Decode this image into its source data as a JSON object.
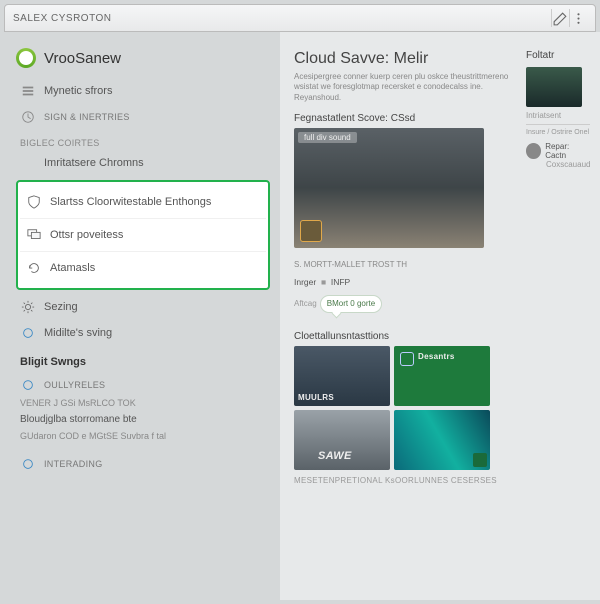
{
  "titlebar": {
    "title": "SALEX CYSROTON"
  },
  "sidebar": {
    "brand": "VrooSanew",
    "items": [
      {
        "icon": "stack",
        "label": "Mynetic sfrors"
      },
      {
        "icon": "clock",
        "label": "SIGN & INERTRIES"
      }
    ],
    "group1_label": "BIGLEC COIRTES",
    "group1": [
      {
        "icon": "",
        "label": "Imritatsere Chromns"
      }
    ],
    "highlighted": [
      {
        "icon": "shield",
        "label": "Slartss Cloorwitestable Enthongs"
      },
      {
        "icon": "monitor",
        "label": "Ottsr poveitess"
      },
      {
        "icon": "refresh",
        "label": "Atamasls"
      }
    ],
    "after": [
      {
        "icon": "gear",
        "label": "Sezing"
      },
      {
        "icon": "circle",
        "label": "Midilte's sving"
      }
    ],
    "section2_header": "Bligit Swngs",
    "section2": [
      {
        "icon": "dot",
        "label": "OULLYRELES"
      }
    ],
    "footer_lines": [
      "VENER J GSi MsRLCO TOK",
      "Bloudjglba storromane bte",
      "GUdaron COD e MGtSE Suvbra f tal"
    ],
    "bottom": {
      "icon": "dot",
      "label": "INTERADING"
    }
  },
  "content": {
    "heading": "Cloud Savve: Melir",
    "description": "Acesipergree conner kuerp ceren plu oskce theustrittmereno wsistat we foresglotmap recersket e conodecalss ine. Reyanshoud.",
    "subhead": "Fegnastatlent Scove: CSsd",
    "hero_tag": "full div sound",
    "caption_line": "S. MORTT-MALLET TROST TH",
    "meta_label": "Inrger",
    "meta_value": "INFP",
    "attach_label": "Aftcag",
    "bubble": "BMort 0 gorte",
    "section2": "Cloettallunsntasttions",
    "thumbs": [
      {
        "cap": "MUULRS"
      },
      {
        "cap": "Desantrs"
      },
      {
        "cap": "SAWE"
      },
      {
        "cap": ""
      }
    ],
    "bottom_line": "MESETENPRETIONAL  KsOORLUNNES CESERSES"
  },
  "right": {
    "header": "Foltatr",
    "item1": "Intriatsent",
    "meta": "Insure / Ostrire Onel",
    "item2": "Repar: Cactn",
    "item3": "Coxscauaud"
  }
}
